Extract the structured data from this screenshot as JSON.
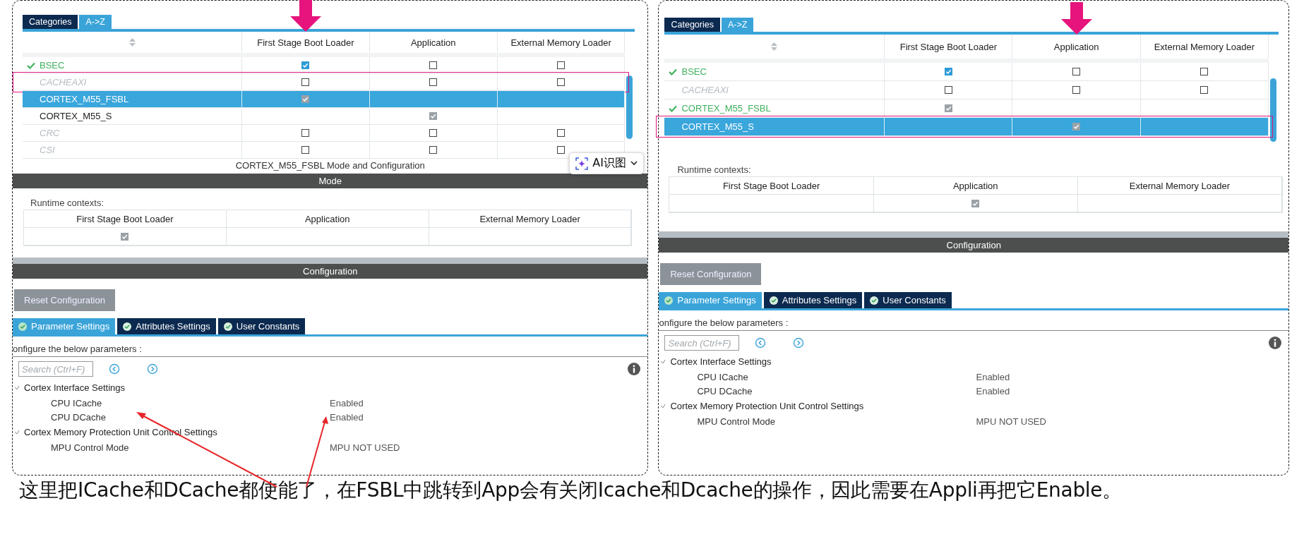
{
  "panels": [
    {
      "peripheral_tabs": [
        {
          "label": "Categories",
          "selected": false
        },
        {
          "label": "A->Z",
          "selected": true
        }
      ],
      "table": {
        "columns": [
          {
            "label": "First Stage Boot Loader",
            "pointed": true
          },
          {
            "label": "Application",
            "pointed": false
          },
          {
            "label": "External Memory Loader",
            "pointed": false
          }
        ],
        "rows": [
          {
            "name": "BSEC",
            "kind": "configured",
            "selected": false,
            "highlighted": false,
            "cells": [
              {
                "kind": "checkbox",
                "checked": true,
                "disabled": false
              },
              {
                "kind": "checkbox",
                "checked": false,
                "disabled": false
              },
              {
                "kind": "checkbox",
                "checked": false,
                "disabled": false
              }
            ]
          },
          {
            "name": "CACHEAXI",
            "kind": "unavailable",
            "selected": false,
            "highlighted": true,
            "cells": [
              {
                "kind": "checkbox",
                "checked": false,
                "disabled": false
              },
              {
                "kind": "checkbox",
                "checked": false,
                "disabled": false
              },
              {
                "kind": "checkbox",
                "checked": false,
                "disabled": false
              }
            ]
          },
          {
            "name": "CORTEX_M55_FSBL",
            "kind": "plain",
            "selected": true,
            "highlighted": false,
            "cells": [
              {
                "kind": "checkbox",
                "checked": true,
                "disabled": true
              },
              {
                "kind": "empty"
              },
              {
                "kind": "empty"
              }
            ]
          },
          {
            "name": "CORTEX_M55_S",
            "kind": "plain",
            "selected": false,
            "highlighted": false,
            "cells": [
              {
                "kind": "empty"
              },
              {
                "kind": "checkbox",
                "checked": true,
                "disabled": true
              },
              {
                "kind": "empty"
              }
            ]
          },
          {
            "name": "CRC",
            "kind": "unavailable",
            "selected": false,
            "highlighted": false,
            "cells": [
              {
                "kind": "checkbox",
                "checked": false,
                "disabled": false
              },
              {
                "kind": "checkbox",
                "checked": false,
                "disabled": false
              },
              {
                "kind": "checkbox",
                "checked": false,
                "disabled": false
              }
            ]
          },
          {
            "name": "CSI",
            "kind": "unavailable",
            "selected": false,
            "highlighted": false,
            "cells": [
              {
                "kind": "checkbox",
                "checked": false,
                "disabled": false
              },
              {
                "kind": "checkbox",
                "checked": false,
                "disabled": false
              },
              {
                "kind": "checkbox",
                "checked": false,
                "disabled": false
              }
            ]
          }
        ]
      },
      "mode_title": "CORTEX_M55_FSBL Mode and Configuration",
      "mode_header": "Mode",
      "runtime": {
        "label": "Runtime contexts:",
        "columns": [
          "First Stage Boot Loader",
          "Application",
          "External Memory Loader"
        ],
        "cells": [
          {
            "kind": "checkbox",
            "checked": true,
            "disabled": true
          },
          {
            "kind": "empty"
          },
          {
            "kind": "empty"
          }
        ]
      },
      "config_header": "Configuration",
      "reset_button": "Reset Configuration",
      "config_tabs": [
        {
          "label": "Parameter Settings",
          "selected": true
        },
        {
          "label": "Attributes Settings",
          "selected": false
        },
        {
          "label": "User Constants",
          "selected": false
        }
      ],
      "hint": "onfigure the below parameters :",
      "search": {
        "placeholder": "Search (Ctrl+F)"
      },
      "params": [
        {
          "label": "Cortex Interface Settings",
          "expanded": true,
          "children": [
            {
              "label": "CPU ICache",
              "value": "Enabled"
            },
            {
              "label": "CPU DCache",
              "value": "Enabled"
            }
          ]
        },
        {
          "label": "Cortex Memory Protection Unit Control Settings",
          "expanded": true,
          "children": [
            {
              "label": "MPU Control Mode",
              "value": "MPU NOT USED"
            }
          ]
        }
      ]
    },
    {
      "peripheral_tabs": [
        {
          "label": "Categories",
          "selected": false
        },
        {
          "label": "A->Z",
          "selected": true
        }
      ],
      "table": {
        "columns": [
          {
            "label": "First Stage Boot Loader",
            "pointed": false
          },
          {
            "label": "Application",
            "pointed": true
          },
          {
            "label": "External Memory Loader",
            "pointed": false
          }
        ],
        "rows": [
          {
            "name": "BSEC",
            "kind": "configured",
            "selected": false,
            "highlighted": false,
            "cells": [
              {
                "kind": "checkbox",
                "checked": true,
                "disabled": false
              },
              {
                "kind": "checkbox",
                "checked": false,
                "disabled": false
              },
              {
                "kind": "checkbox",
                "checked": false,
                "disabled": false
              }
            ]
          },
          {
            "name": "CACHEAXI",
            "kind": "unavailable",
            "selected": false,
            "highlighted": false,
            "cells": [
              {
                "kind": "checkbox",
                "checked": false,
                "disabled": false
              },
              {
                "kind": "checkbox",
                "checked": false,
                "disabled": false
              },
              {
                "kind": "checkbox",
                "checked": false,
                "disabled": false
              }
            ]
          },
          {
            "name": "CORTEX_M55_FSBL",
            "kind": "configured",
            "selected": false,
            "highlighted": false,
            "cells": [
              {
                "kind": "checkbox",
                "checked": true,
                "disabled": true
              },
              {
                "kind": "empty"
              },
              {
                "kind": "empty"
              }
            ]
          },
          {
            "name": "CORTEX_M55_S",
            "kind": "plain",
            "selected": true,
            "highlighted": true,
            "cells": [
              {
                "kind": "empty"
              },
              {
                "kind": "checkbox",
                "checked": true,
                "disabled": true
              },
              {
                "kind": "empty"
              }
            ]
          }
        ]
      },
      "runtime": {
        "label": "Runtime contexts:",
        "columns": [
          "First Stage Boot Loader",
          "Application",
          "External Memory Loader"
        ],
        "cells": [
          {
            "kind": "empty"
          },
          {
            "kind": "checkbox",
            "checked": true,
            "disabled": true
          },
          {
            "kind": "empty"
          }
        ]
      },
      "config_header": "Configuration",
      "reset_button": "Reset Configuration",
      "config_tabs": [
        {
          "label": "Parameter Settings",
          "selected": true
        },
        {
          "label": "Attributes Settings",
          "selected": false
        },
        {
          "label": "User Constants",
          "selected": false
        }
      ],
      "hint": "onfigure the below parameters :",
      "search": {
        "placeholder": "Search (Ctrl+F)"
      },
      "params": [
        {
          "label": "Cortex Interface Settings",
          "expanded": true,
          "children": [
            {
              "label": "CPU ICache",
              "value": "Enabled"
            },
            {
              "label": "CPU DCache",
              "value": "Enabled"
            }
          ]
        },
        {
          "label": "Cortex Memory Protection Unit Control Settings",
          "expanded": true,
          "children": [
            {
              "label": "MPU Control Mode",
              "value": "MPU NOT USED"
            }
          ]
        }
      ]
    }
  ],
  "overlay_button": {
    "label": "AI识图"
  },
  "caption": "这里把ICache和DCache都使能了，在FSBL中跳转到App会有关闭Icache和Dcache的操作，因此需要在Appli再把它Enable。"
}
